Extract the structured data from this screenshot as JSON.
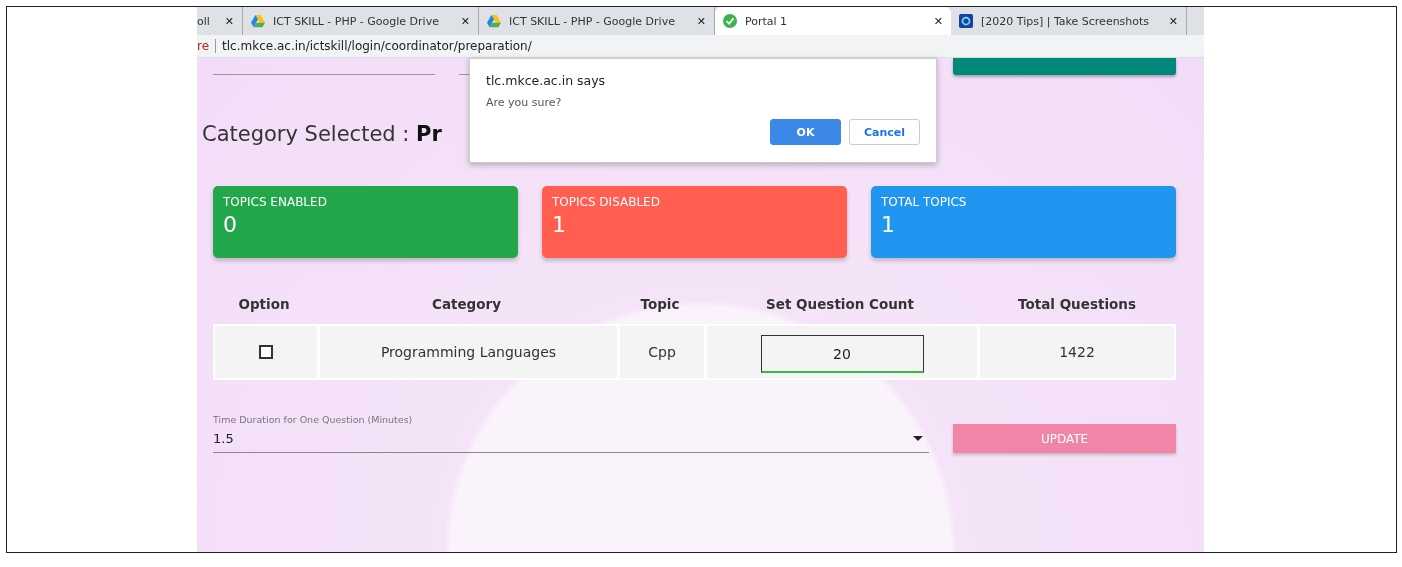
{
  "browser": {
    "tabs": [
      {
        "title": "oll",
        "selected": false,
        "kind": "plain",
        "close": "✕"
      },
      {
        "title": "ICT SKILL - PHP - Google Drive",
        "selected": false,
        "kind": "drive",
        "close": "✕"
      },
      {
        "title": "ICT SKILL - PHP - Google Drive",
        "selected": false,
        "kind": "drive",
        "close": "✕"
      },
      {
        "title": "Portal 1",
        "selected": true,
        "kind": "check",
        "close": "✕"
      },
      {
        "title": "[2020 Tips] | Take Screenshots",
        "selected": false,
        "kind": "site",
        "close": "✕"
      }
    ],
    "address_prefix": "re",
    "address": "tlc.mkce.ac.in/ictskill/login/coordinator/preparation/"
  },
  "heading": "Category Selected : **Pr**",
  "stats": [
    {
      "label": "TOPICS ENABLED",
      "value": "0",
      "color": "#22a84a"
    },
    {
      "label": "TOPICS DISABLED",
      "value": "1",
      "color": "#ff5e50"
    },
    {
      "label": "TOTAL TOPICS",
      "value": "1",
      "color": "#2196f0"
    }
  ],
  "table": {
    "columns": [
      "Option",
      "Category",
      "Topic",
      "Set Question Count",
      "Total Questions"
    ],
    "rows": [
      {
        "checked": false,
        "category": "Programming Languages",
        "topic": "Cpp",
        "count": "20",
        "total": "1422"
      }
    ]
  },
  "duration": {
    "label": "Time Duration for One Question (Minutes)",
    "value": "1.5"
  },
  "update_button": "UPDATE",
  "dialog": {
    "title": "tlc.mkce.ac.in says",
    "message": "Are you sure?",
    "buttons": [
      {
        "label": "OK",
        "primary": true
      },
      {
        "label": "Cancel",
        "primary": false
      }
    ]
  }
}
